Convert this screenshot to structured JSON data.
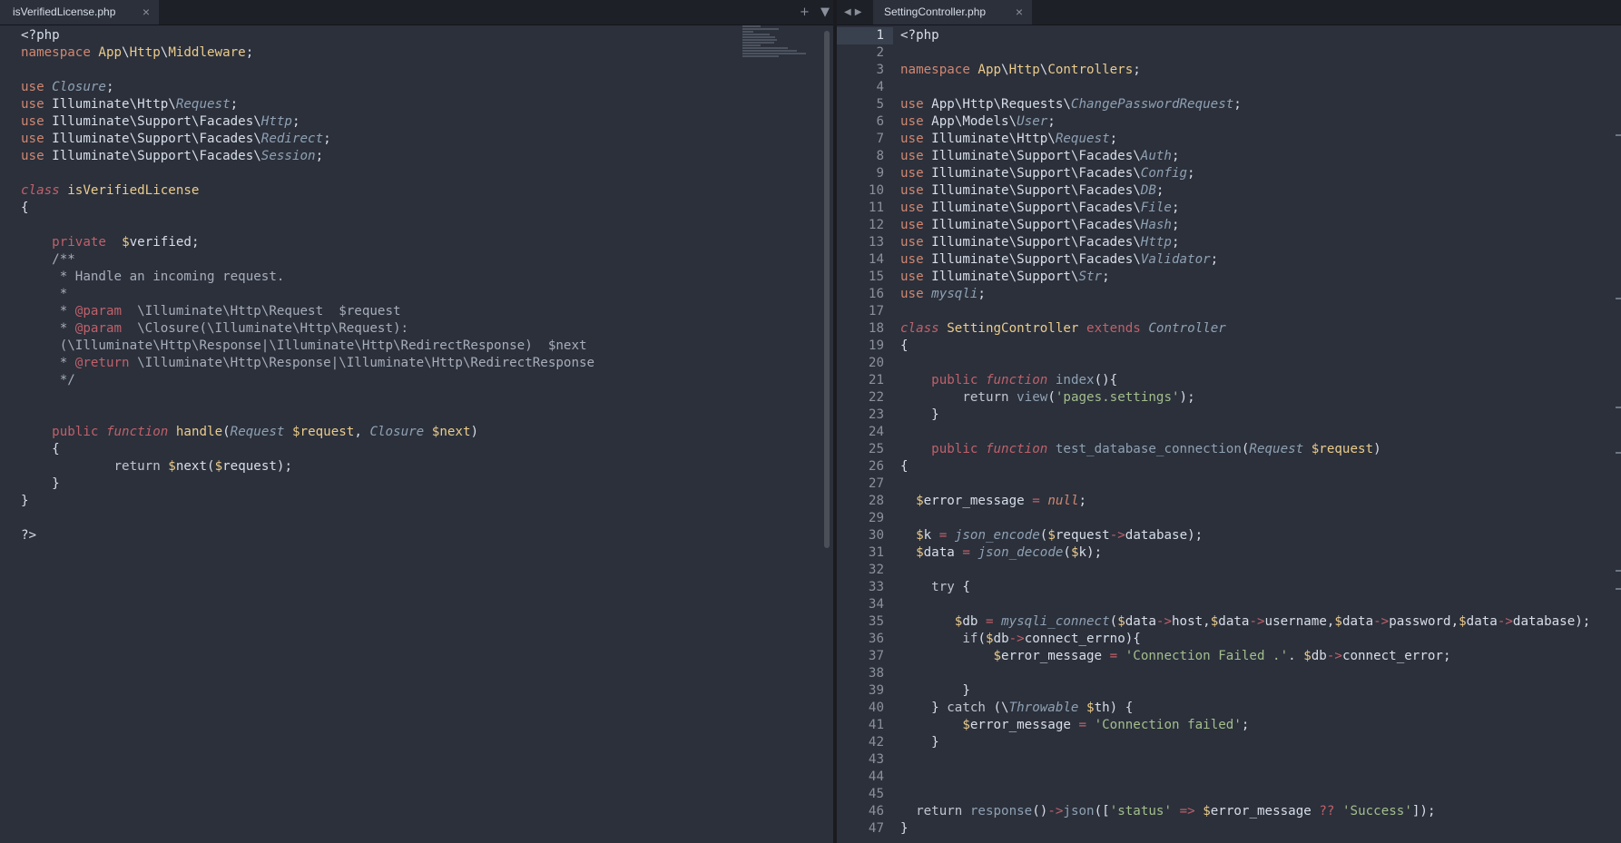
{
  "left_tab": {
    "title": "isVerifiedLicense.php",
    "close": "×"
  },
  "left_controls": {
    "add": "+",
    "menu": "▼"
  },
  "right_nav": {
    "prev": "◀",
    "next": "▶"
  },
  "right_tab": {
    "title": "SettingController.php",
    "close": "×"
  },
  "line_numbers": [
    "1",
    "2",
    "3",
    "4",
    "5",
    "6",
    "7",
    "8",
    "9",
    "10",
    "11",
    "12",
    "13",
    "14",
    "15",
    "16",
    "17",
    "18",
    "19",
    "20",
    "21",
    "22",
    "23",
    "24",
    "25",
    "26",
    "27",
    "28",
    "29",
    "30",
    "31",
    "32",
    "33",
    "34",
    "35",
    "36",
    "37",
    "38",
    "39",
    "40",
    "41",
    "42",
    "43",
    "44",
    "45",
    "46",
    "47"
  ],
  "active_line": "1",
  "icons": {
    "close": "close-icon",
    "add": "plus-icon",
    "menu": "chevron-down-icon",
    "nav": "arrow-icon"
  }
}
